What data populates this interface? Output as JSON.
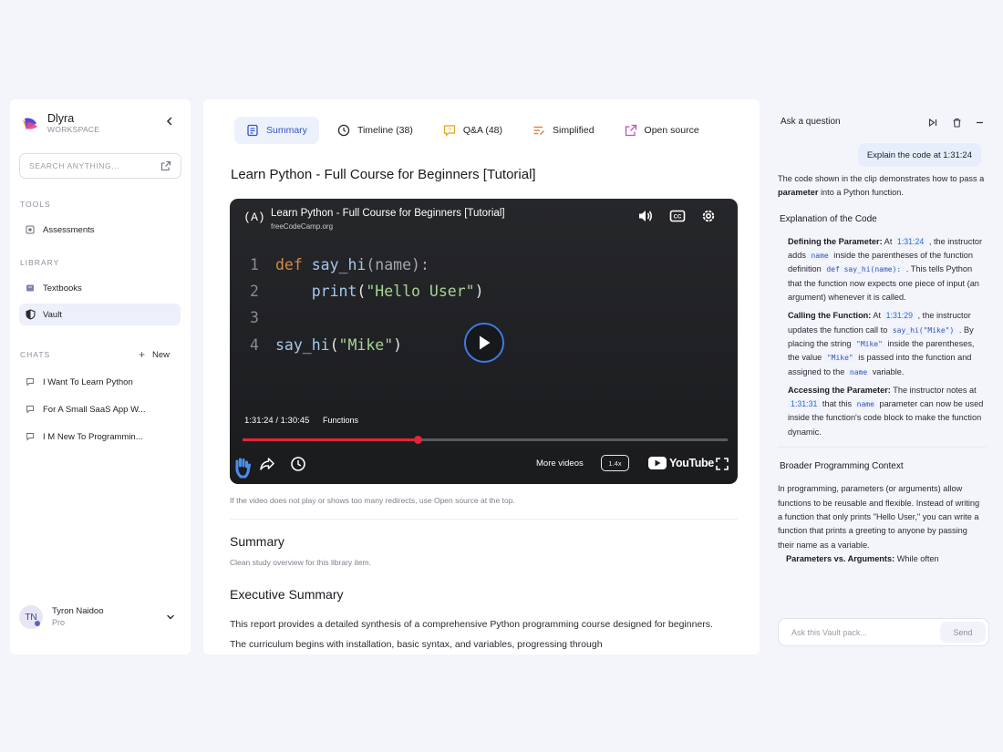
{
  "brand": {
    "name": "Dlyra",
    "subtitle": "WORKSPACE"
  },
  "search": {
    "placeholder": "SEARCH ANYTHING..."
  },
  "sidebar": {
    "tools_label": "TOOLS",
    "tools": [
      {
        "label": "Assessments"
      }
    ],
    "library_label": "LIBRARY",
    "library": [
      {
        "label": "Textbooks"
      },
      {
        "label": "Vault"
      }
    ],
    "chats_label": "CHATS",
    "new_label": "New",
    "chats": [
      {
        "label": "I Want To Learn Python"
      },
      {
        "label": "For A Small SaaS App W..."
      },
      {
        "label": "I M New To Programmin..."
      }
    ]
  },
  "user": {
    "initials": "TN",
    "name": "Tyron Naidoo",
    "plan": "Pro"
  },
  "tabs": [
    {
      "label": "Summary"
    },
    {
      "label": "Timeline (38)"
    },
    {
      "label": "Q&A (48)"
    },
    {
      "label": "Simplified"
    },
    {
      "label": "Open source"
    }
  ],
  "page_title": "Learn Python - Full Course for Beginners [Tutorial]",
  "video": {
    "logo_text": "(A)",
    "title": "Learn Python - Full Course for Beginners [Tutorial]",
    "channel": "freeCodeCamp.org",
    "code": {
      "line_numbers": [
        "1",
        "2",
        "3",
        "4"
      ],
      "l1_kw": "def",
      "l1_fn": "say_hi",
      "l1_rest": "(name):",
      "l2_fn": "print",
      "l2_open": "(",
      "l2_str": "\"Hello User\"",
      "l2_close": ")",
      "l4_fn": "say_hi",
      "l4_open": "(",
      "l4_str": "\"Mike\"",
      "l4_close": ")"
    },
    "time": "1:31:24 / 1:30:45",
    "chapter": "Functions",
    "progress": 0.36,
    "more_videos": "More videos",
    "speed": "1.4x",
    "youtube": "YouTube"
  },
  "video_note": "If the video does not play or shows too many redirects, use Open source at the top.",
  "summary": {
    "title": "Summary",
    "subtitle": "Clean study overview for this library item."
  },
  "executive": {
    "title": "Executive Summary",
    "text": "This report provides a detailed synthesis of a comprehensive Python programming course designed for beginners. The curriculum begins with installation, basic syntax, and variables, progressing through"
  },
  "chat": {
    "title": "Ask a question",
    "user_message": "Explain the code at 1:31:24",
    "intro_a": "The code shown in the clip demonstrates how to pass a ",
    "intro_b": "parameter",
    "intro_c": " into a Python function.",
    "h1": "Explanation of the Code",
    "i1_label": "Defining the Parameter:",
    "i1_a": " At ",
    "i1_ts": "1:31:24",
    "i1_b": " , the instructor adds ",
    "i1_m1": "name",
    "i1_c": " inside the parentheses of the function definition ",
    "i1_m2": "def say_hi(name):",
    "i1_d": " . This tells Python that the function now expects one piece of input (an argument) whenever it is called.",
    "i2_label": "Calling the Function:",
    "i2_a": " At ",
    "i2_ts": "1:31:29",
    "i2_b": " , the instructor updates the function call to ",
    "i2_m1": "say_hi(\"Mike\")",
    "i2_c": " . By placing the string ",
    "i2_m2": "\"Mike\"",
    "i2_d": " inside the parentheses, the value ",
    "i2_m3": "\"Mike\"",
    "i2_e": " is passed into the function and assigned to the ",
    "i2_m4": "name",
    "i2_f": " variable.",
    "i3_label": "Accessing the Parameter:",
    "i3_a": " The instructor notes at ",
    "i3_ts": "1:31:31",
    "i3_b": " that this ",
    "i3_m1": "name",
    "i3_c": " parameter can now be used inside the function's code block to make the function dynamic.",
    "h2": "Broader Programming Context",
    "context": "In programming, parameters (or arguments) allow functions to be reusable and flexible. Instead of writing a function that only prints \"Hello User,\" you can write a function that prints a greeting to anyone by passing their name as a variable.",
    "p_label": "Parameters vs. Arguments:",
    "p_text": " While often",
    "input_placeholder": "Ask this Vault pack...",
    "send_label": "Send"
  },
  "colors": {
    "accent": "#2f55c8",
    "progress": "#e5233a",
    "panel": "#ffffff",
    "page_bg": "#f4f5fa"
  }
}
